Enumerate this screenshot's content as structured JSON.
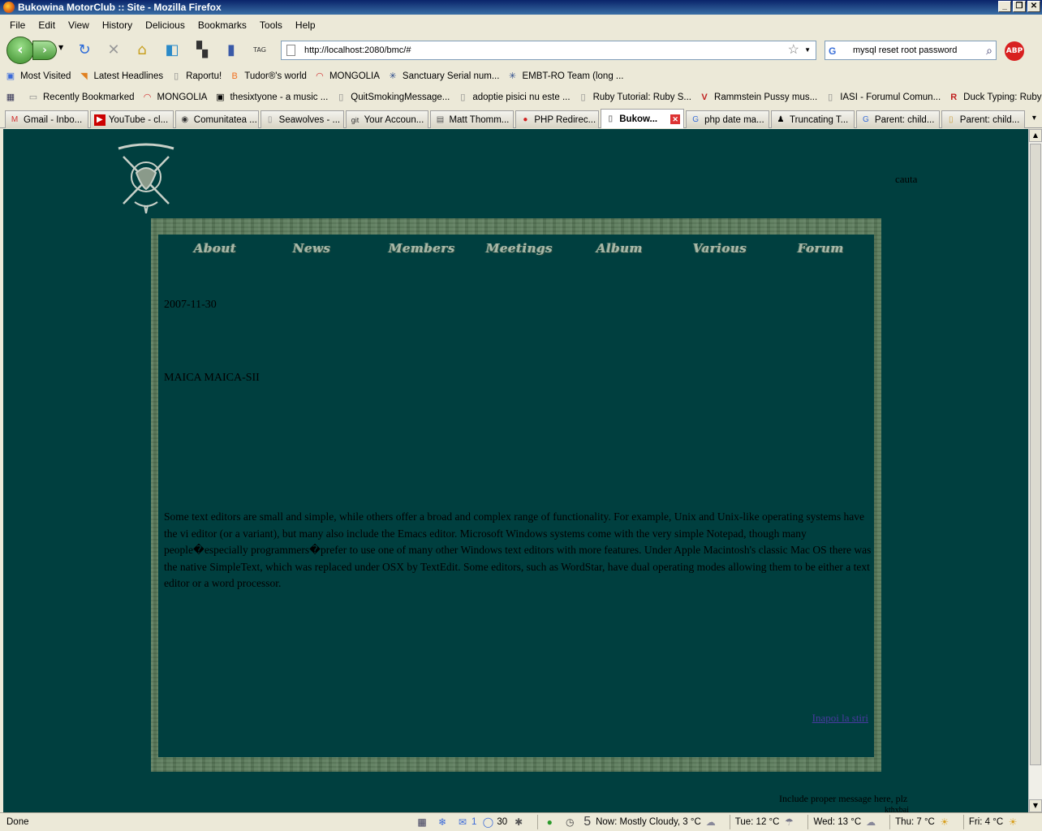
{
  "window": {
    "title": "Bukowina MotorClub :: Site - Mozilla Firefox"
  },
  "menu": [
    "File",
    "Edit",
    "View",
    "History",
    "Delicious",
    "Bookmarks",
    "Tools",
    "Help"
  ],
  "toolbar": {
    "url": "http://localhost:2080/bmc/#",
    "search_value": "mysql reset root password",
    "abp_label": "ABP",
    "tag_label": "TAG"
  },
  "bookmarks_bar_1": [
    "Most Visited",
    "Latest Headlines",
    "Raportu!",
    "Tudor®'s world",
    "MONGOLIA",
    "Sanctuary Serial num...",
    "EMBT-RO Team (long ..."
  ],
  "bookmarks_bar_2": [
    "Recently Bookmarked",
    "MONGOLIA",
    "thesixtyone - a music ...",
    "QuitSmokingMessage...",
    "adoptie pisici nu este ...",
    "Ruby Tutorial: Ruby S...",
    "Rammstein Pussy mus...",
    "IASI - Forumul Comun...",
    "Duck Typing: Ruby St..."
  ],
  "tabs": [
    {
      "label": "Gmail - Inbo...",
      "icon": "gmail-icon"
    },
    {
      "label": "YouTube - cl...",
      "icon": "youtube-icon"
    },
    {
      "label": "Comunitatea ...",
      "icon": "site-icon"
    },
    {
      "label": "Seawolves - ...",
      "icon": "page-icon"
    },
    {
      "label": "Your Accoun...",
      "icon": "git-icon"
    },
    {
      "label": "Matt Thomm...",
      "icon": "site-icon"
    },
    {
      "label": "PHP Redirec...",
      "icon": "red-dot-icon"
    },
    {
      "label": "Bukow...",
      "icon": "page-icon",
      "active": true
    },
    {
      "label": "php date ma...",
      "icon": "google-icon"
    },
    {
      "label": "Truncating T...",
      "icon": "penguin-icon"
    },
    {
      "label": "Parent: child...",
      "icon": "google-icon"
    },
    {
      "label": "Parent: child...",
      "icon": "page-icon"
    }
  ],
  "page": {
    "search_label": "cauta",
    "nav": [
      "About",
      "News",
      "Members",
      "Meetings",
      "Album",
      "Various",
      "Forum"
    ],
    "post": {
      "date": "2007-11-30",
      "title": "MAICA MAICA-SII",
      "body": "Some text editors are small and simple, while others offer a broad and complex range of functionality. For example, Unix and Unix-like operating systems have the vi editor (or a variant), but many also include the Emacs editor. Microsoft Windows systems come with the very simple Notepad, though many people�especially programmers�prefer to use one of many other Windows text editors with more features. Under Apple Macintosh's classic Mac OS there was the native SimpleText, which was replaced under OSX by TextEdit. Some editors, such as WordStar, have dual operating modes allowing them to be either a text editor or a word processor.",
      "back_link": "Inapoi la stiri"
    },
    "footer": "Include proper message here, plz",
    "footer_cut": "kthxbai"
  },
  "status": {
    "text": "Done",
    "mail_count": "1",
    "chat_count": "30",
    "tab_count": "5",
    "weather": [
      {
        "label": "Now: Mostly Cloudy, 3 °C",
        "icon": "partly-cloudy-icon"
      },
      {
        "label": "Tue: 12 °C",
        "icon": "rain-cloud-icon"
      },
      {
        "label": "Wed: 13 °C",
        "icon": "cloud-icon"
      },
      {
        "label": "Thu: 7 °C",
        "icon": "sun-cloud-icon"
      },
      {
        "label": "Fri: 4 °C",
        "icon": "sun-cloud-icon"
      }
    ]
  },
  "colors": {
    "page_bg": "#003f3f",
    "frame": "#5a7a5a",
    "nav_text": "#a8b8a8",
    "link": "#4a3aa0"
  }
}
